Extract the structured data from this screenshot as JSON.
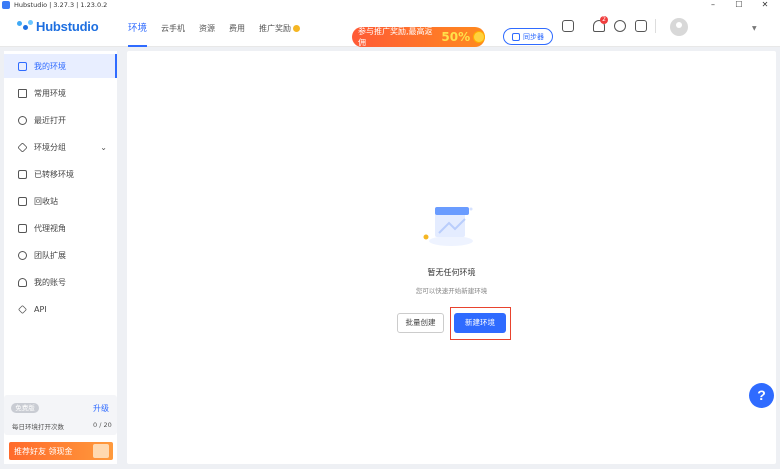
{
  "window": {
    "title": "Hubstudio | 3.27.3 | 1.23.0.2",
    "minimize": "–",
    "maximize": "☐",
    "close": "✕"
  },
  "header": {
    "logo": "Hubstudio",
    "nav": [
      {
        "label": "环境",
        "active": true
      },
      {
        "label": "云手机"
      },
      {
        "label": "资源"
      },
      {
        "label": "费用"
      },
      {
        "label": "推广奖励"
      }
    ],
    "promo": {
      "text": "参与推广奖励,最高返佣",
      "percent": "50%"
    },
    "sync_label": "同步器",
    "notification_count": "2"
  },
  "sidebar": {
    "items": [
      {
        "label": "我的环境",
        "icon": "folder-icon",
        "active": true
      },
      {
        "label": "常用环境",
        "icon": "star-icon"
      },
      {
        "label": "最近打开",
        "icon": "clock-icon"
      },
      {
        "label": "环境分组",
        "icon": "layers-icon",
        "expandable": true
      },
      {
        "label": "已转移环境",
        "icon": "transfer-icon"
      },
      {
        "label": "回收站",
        "icon": "trash-icon"
      },
      {
        "label": "代理视角",
        "icon": "proxy-icon"
      },
      {
        "label": "团队扩展",
        "icon": "extension-icon"
      },
      {
        "label": "我的账号",
        "icon": "user-icon"
      },
      {
        "label": "API",
        "icon": "api-icon"
      }
    ],
    "plan": {
      "badge": "免费版",
      "upgrade": "升级",
      "label": "每日环境打开次数",
      "count": "0 / 20"
    },
    "referral": "推荐好友 领现金"
  },
  "main": {
    "empty_title": "暂无任何环境",
    "empty_subtitle": "您可以快速开始新建环境",
    "batch_create": "批量创建",
    "new_env": "新建环境"
  },
  "help": "?",
  "colors": {
    "primary": "#2f6bff",
    "highlight": "#e8432e",
    "promo": "#ff5a36"
  }
}
